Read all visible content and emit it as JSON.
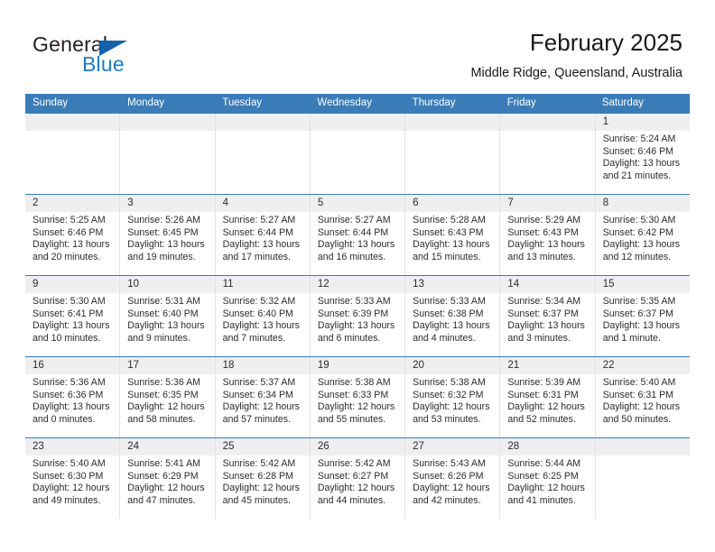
{
  "brand": {
    "name_part1": "General",
    "name_part2": "Blue",
    "accent_color": "#1361a8",
    "text_color": "#231f20"
  },
  "header": {
    "title": "February 2025",
    "location": "Middle Ridge, Queensland, Australia",
    "header_bg_color": "#3a7cb8",
    "date_band_color": "#efefef"
  },
  "weekdays": [
    "Sunday",
    "Monday",
    "Tuesday",
    "Wednesday",
    "Thursday",
    "Friday",
    "Saturday"
  ],
  "weeks": [
    [
      {
        "day": "",
        "info": ""
      },
      {
        "day": "",
        "info": ""
      },
      {
        "day": "",
        "info": ""
      },
      {
        "day": "",
        "info": ""
      },
      {
        "day": "",
        "info": ""
      },
      {
        "day": "",
        "info": ""
      },
      {
        "day": "1",
        "info": "Sunrise: 5:24 AM\nSunset: 6:46 PM\nDaylight: 13 hours\nand 21 minutes."
      }
    ],
    [
      {
        "day": "2",
        "info": "Sunrise: 5:25 AM\nSunset: 6:46 PM\nDaylight: 13 hours\nand 20 minutes."
      },
      {
        "day": "3",
        "info": "Sunrise: 5:26 AM\nSunset: 6:45 PM\nDaylight: 13 hours\nand 19 minutes."
      },
      {
        "day": "4",
        "info": "Sunrise: 5:27 AM\nSunset: 6:44 PM\nDaylight: 13 hours\nand 17 minutes."
      },
      {
        "day": "5",
        "info": "Sunrise: 5:27 AM\nSunset: 6:44 PM\nDaylight: 13 hours\nand 16 minutes."
      },
      {
        "day": "6",
        "info": "Sunrise: 5:28 AM\nSunset: 6:43 PM\nDaylight: 13 hours\nand 15 minutes."
      },
      {
        "day": "7",
        "info": "Sunrise: 5:29 AM\nSunset: 6:43 PM\nDaylight: 13 hours\nand 13 minutes."
      },
      {
        "day": "8",
        "info": "Sunrise: 5:30 AM\nSunset: 6:42 PM\nDaylight: 13 hours\nand 12 minutes."
      }
    ],
    [
      {
        "day": "9",
        "info": "Sunrise: 5:30 AM\nSunset: 6:41 PM\nDaylight: 13 hours\nand 10 minutes."
      },
      {
        "day": "10",
        "info": "Sunrise: 5:31 AM\nSunset: 6:40 PM\nDaylight: 13 hours\nand 9 minutes."
      },
      {
        "day": "11",
        "info": "Sunrise: 5:32 AM\nSunset: 6:40 PM\nDaylight: 13 hours\nand 7 minutes."
      },
      {
        "day": "12",
        "info": "Sunrise: 5:33 AM\nSunset: 6:39 PM\nDaylight: 13 hours\nand 6 minutes."
      },
      {
        "day": "13",
        "info": "Sunrise: 5:33 AM\nSunset: 6:38 PM\nDaylight: 13 hours\nand 4 minutes."
      },
      {
        "day": "14",
        "info": "Sunrise: 5:34 AM\nSunset: 6:37 PM\nDaylight: 13 hours\nand 3 minutes."
      },
      {
        "day": "15",
        "info": "Sunrise: 5:35 AM\nSunset: 6:37 PM\nDaylight: 13 hours\nand 1 minute."
      }
    ],
    [
      {
        "day": "16",
        "info": "Sunrise: 5:36 AM\nSunset: 6:36 PM\nDaylight: 13 hours\nand 0 minutes."
      },
      {
        "day": "17",
        "info": "Sunrise: 5:36 AM\nSunset: 6:35 PM\nDaylight: 12 hours\nand 58 minutes."
      },
      {
        "day": "18",
        "info": "Sunrise: 5:37 AM\nSunset: 6:34 PM\nDaylight: 12 hours\nand 57 minutes."
      },
      {
        "day": "19",
        "info": "Sunrise: 5:38 AM\nSunset: 6:33 PM\nDaylight: 12 hours\nand 55 minutes."
      },
      {
        "day": "20",
        "info": "Sunrise: 5:38 AM\nSunset: 6:32 PM\nDaylight: 12 hours\nand 53 minutes."
      },
      {
        "day": "21",
        "info": "Sunrise: 5:39 AM\nSunset: 6:31 PM\nDaylight: 12 hours\nand 52 minutes."
      },
      {
        "day": "22",
        "info": "Sunrise: 5:40 AM\nSunset: 6:31 PM\nDaylight: 12 hours\nand 50 minutes."
      }
    ],
    [
      {
        "day": "23",
        "info": "Sunrise: 5:40 AM\nSunset: 6:30 PM\nDaylight: 12 hours\nand 49 minutes."
      },
      {
        "day": "24",
        "info": "Sunrise: 5:41 AM\nSunset: 6:29 PM\nDaylight: 12 hours\nand 47 minutes."
      },
      {
        "day": "25",
        "info": "Sunrise: 5:42 AM\nSunset: 6:28 PM\nDaylight: 12 hours\nand 45 minutes."
      },
      {
        "day": "26",
        "info": "Sunrise: 5:42 AM\nSunset: 6:27 PM\nDaylight: 12 hours\nand 44 minutes."
      },
      {
        "day": "27",
        "info": "Sunrise: 5:43 AM\nSunset: 6:26 PM\nDaylight: 12 hours\nand 42 minutes."
      },
      {
        "day": "28",
        "info": "Sunrise: 5:44 AM\nSunset: 6:25 PM\nDaylight: 12 hours\nand 41 minutes."
      },
      {
        "day": "",
        "info": ""
      }
    ]
  ]
}
